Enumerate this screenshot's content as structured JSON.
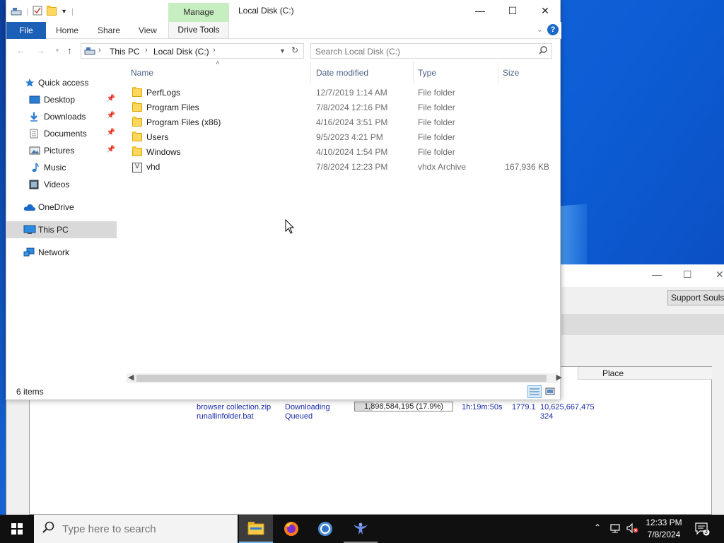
{
  "explorer": {
    "title": "Local Disk (C:)",
    "context_tab": "Manage",
    "ribbon_tabs": {
      "file": "File",
      "home": "Home",
      "share": "Share",
      "view": "View",
      "drive_tools": "Drive Tools"
    },
    "help_label": "?",
    "address": {
      "crumbs": [
        "This PC",
        "Local Disk (C:)"
      ]
    },
    "search_placeholder": "Search Local Disk (C:)",
    "nav": {
      "quick_access": "Quick access",
      "items": [
        {
          "label": "Desktop",
          "pinned": true
        },
        {
          "label": "Downloads",
          "pinned": true
        },
        {
          "label": "Documents",
          "pinned": true
        },
        {
          "label": "Pictures",
          "pinned": true
        },
        {
          "label": "Music",
          "pinned": false
        },
        {
          "label": "Videos",
          "pinned": false
        }
      ],
      "onedrive": "OneDrive",
      "this_pc": "This PC",
      "network": "Network"
    },
    "columns": {
      "name": "Name",
      "date": "Date modified",
      "type": "Type",
      "size": "Size"
    },
    "files": [
      {
        "name": "PerfLogs",
        "date": "12/7/2019 1:14 AM",
        "type": "File folder",
        "size": ""
      },
      {
        "name": "Program Files",
        "date": "7/8/2024 12:16 PM",
        "type": "File folder",
        "size": ""
      },
      {
        "name": "Program Files (x86)",
        "date": "4/16/2024 3:51 PM",
        "type": "File folder",
        "size": ""
      },
      {
        "name": "Users",
        "date": "9/5/2023 4:21 PM",
        "type": "File folder",
        "size": ""
      },
      {
        "name": "Windows",
        "date": "4/10/2024 1:54 PM",
        "type": "File folder",
        "size": ""
      },
      {
        "name": "vhd",
        "date": "7/8/2024 12:23 PM",
        "type": "vhdx Archive",
        "size": "167,936 KB"
      }
    ],
    "status": "6 items"
  },
  "soulseek": {
    "support_button": "Support Soulseek",
    "column_place": "Place",
    "transfers": [
      {
        "file": "browser collection.zip",
        "status": "Downloading",
        "progress_text": "1,898,584,195 (17.9%)",
        "progress": 0.179,
        "time": "1h:19m:50s",
        "speed": "1779.1",
        "size": "10,625,667,475"
      },
      {
        "file": "runallinfolder.bat",
        "status": "Queued",
        "size": "324"
      }
    ]
  },
  "taskbar": {
    "search_placeholder": "Type here to search",
    "time": "12:33 PM",
    "date": "7/8/2024",
    "notification_count": "3"
  },
  "colors": {
    "accent": "#1c5fb6",
    "manage_tab": "#c7eec0",
    "transfer_text": "#1a2ba8"
  }
}
